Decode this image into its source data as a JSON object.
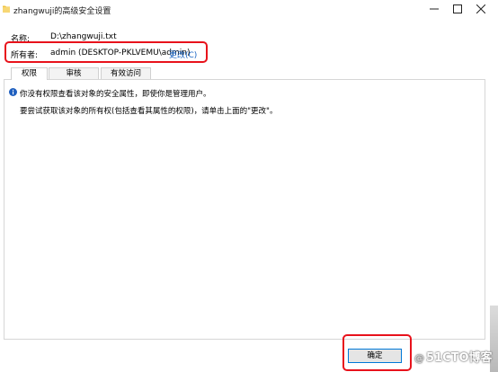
{
  "window": {
    "title": "zhangwuji的高级安全设置"
  },
  "colors": {
    "link": "#1763c3",
    "annotation": "#e8121b",
    "accent": "#0078d7",
    "folder": "#f0c441",
    "info": "#1f5fbf"
  },
  "fields": {
    "name_label": "名称:",
    "name_value": "D:\\zhangwuji.txt",
    "owner_label": "所有者:",
    "owner_value": "admin (DESKTOP-PKLVEMU\\admin)",
    "change_link": "更改(C)"
  },
  "tabs": [
    {
      "label": "权限",
      "active": true
    },
    {
      "label": "审核",
      "active": false
    },
    {
      "label": "有效访问",
      "active": false
    }
  ],
  "messages": {
    "info": "你没有权限查看该对象的安全属性，即使你是管理用户。",
    "try": "要尝试获取该对象的所有权(包括查看其属性的权限)，请单击上面的\"更改\"。"
  },
  "buttons": {
    "ok": "确定"
  },
  "watermark": {
    "at": "@",
    "text": "51CTO博客"
  },
  "icons": {
    "folder": "folder-icon",
    "info": "info-icon",
    "minimize": "minimize-icon",
    "maximize": "maximize-icon",
    "close": "close-icon"
  }
}
